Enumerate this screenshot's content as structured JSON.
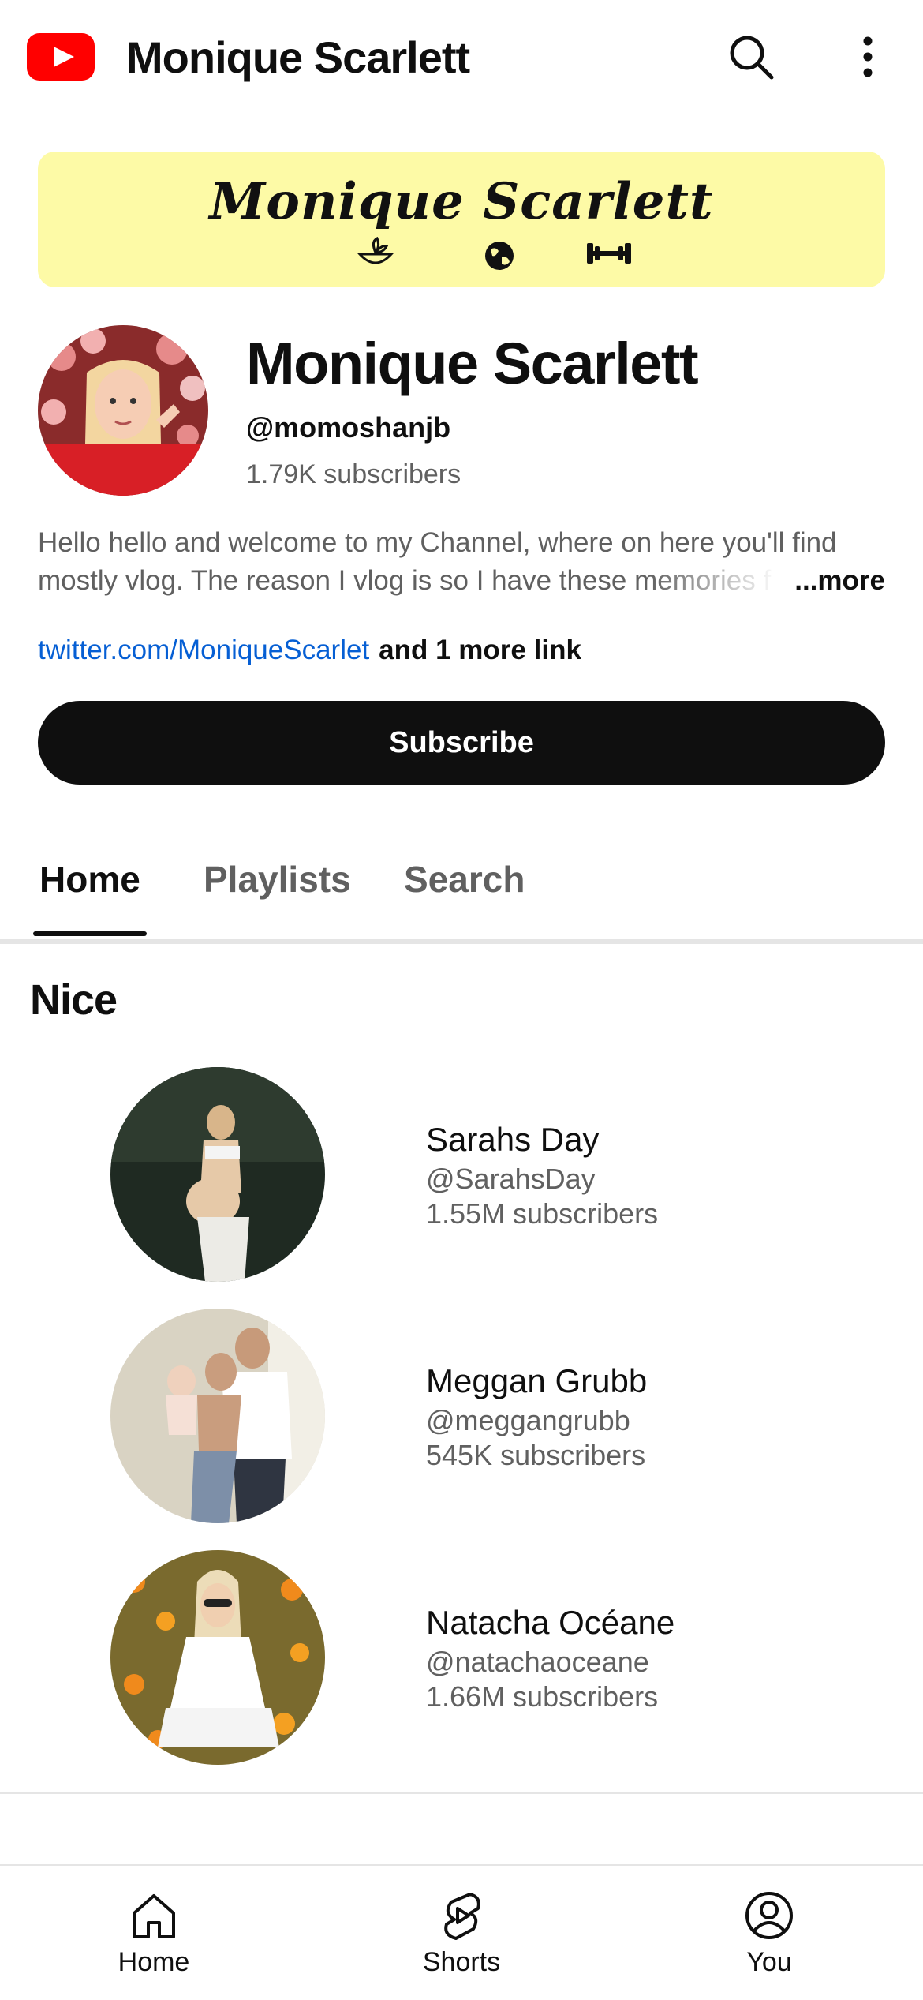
{
  "app_bar": {
    "title": "Monique Scarlett",
    "icons": [
      "youtube-logo",
      "search-icon",
      "more-vert-icon"
    ]
  },
  "banner": {
    "text": "Monique Scarlett",
    "icons": [
      "bowl-icon",
      "globe-icon",
      "dumbbell-icon"
    ],
    "background": "#fdfaa6"
  },
  "channel": {
    "name": "Monique Scarlett",
    "handle": "@momoshanjb",
    "subscribers": "1.79K subscribers",
    "description_line1": "Hello hello and welcome to my Channel, where on here you'll find",
    "description_line2": "mostly vlog. The reason I vlog is so I have these memories f",
    "more_label": "...more",
    "link_text": "twitter.com/MoniqueScarlet",
    "more_links_label": "and 1 more link",
    "subscribe_label": "Subscribe"
  },
  "tabs": [
    {
      "label": "Home",
      "active": true
    },
    {
      "label": "Playlists",
      "active": false
    },
    {
      "label": "Search",
      "active": false
    }
  ],
  "section": {
    "title": "Nice",
    "channels": [
      {
        "name": "Sarahs Day",
        "handle": "@SarahsDay",
        "subscribers": "1.55M subscribers"
      },
      {
        "name": "Meggan Grubb",
        "handle": "@meggangrubb",
        "subscribers": "545K subscribers"
      },
      {
        "name": "Natacha Océane",
        "handle": "@natachaoceane",
        "subscribers": "1.66M subscribers"
      }
    ]
  },
  "bottom_nav": [
    {
      "label": "Home",
      "icon": "home-icon"
    },
    {
      "label": "Shorts",
      "icon": "shorts-icon"
    },
    {
      "label": "You",
      "icon": "account-circle-icon"
    }
  ],
  "colors": {
    "brand_red": "#ff0000",
    "link_blue": "#065fd4",
    "secondary_text": "#606060",
    "subscribe_bg": "#0f0f0f"
  }
}
